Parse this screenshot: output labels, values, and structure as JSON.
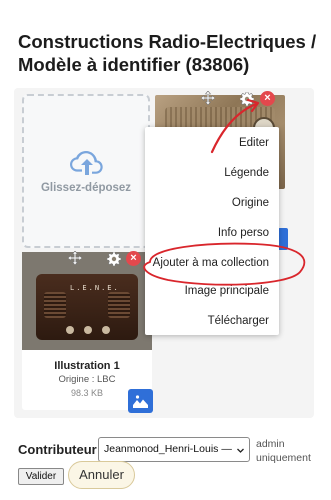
{
  "page": {
    "title": "Constructions Radio-Electriques / Modèle à identifier (83806)"
  },
  "dropzone": {
    "label": "Glissez-déposez"
  },
  "menu": {
    "items": [
      {
        "label": "Editer"
      },
      {
        "label": "Légende"
      },
      {
        "label": "Origine"
      },
      {
        "label": "Info perso"
      },
      {
        "label": "Ajouter à ma collection"
      },
      {
        "label": "Image principale"
      },
      {
        "label": "Télécharger"
      }
    ]
  },
  "card1": {
    "name": "Illustration 1",
    "origin": "Origine : LBC",
    "size": "98.3 KB",
    "brand_text": "L.E.N.E."
  },
  "contributor": {
    "label": "Contributeur",
    "value": "Jeanmonod_Henri-Louis —",
    "note": "admin uniquement"
  },
  "buttons": {
    "valider": "Valider",
    "annuler": "Annuler"
  },
  "colors": {
    "accent_blue": "#2f6fd8",
    "delete_red": "#e3484d",
    "annotation_red": "#d9262c"
  }
}
